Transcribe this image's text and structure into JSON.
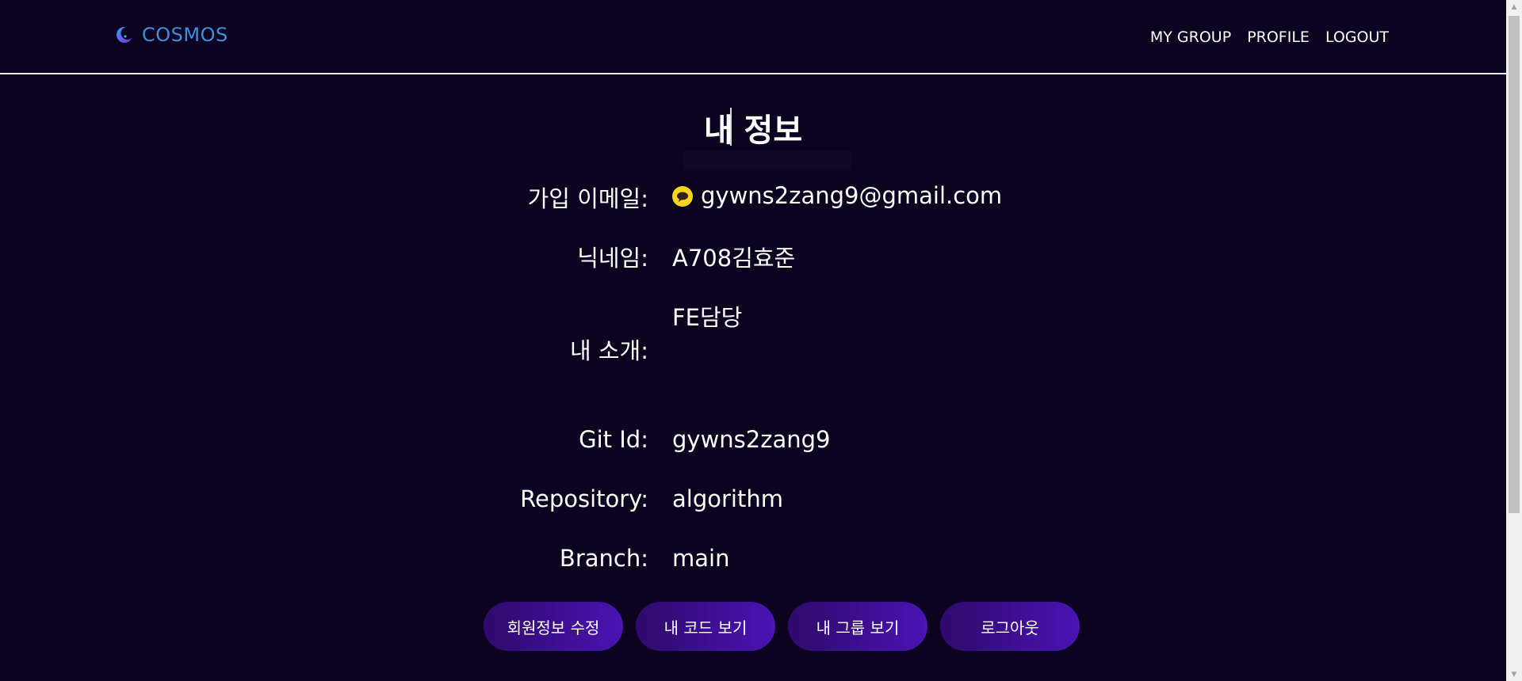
{
  "header": {
    "brand": "COSMOS",
    "nav": {
      "my_group": "MY GROUP",
      "profile": "PROFILE",
      "logout": "LOGOUT"
    }
  },
  "page": {
    "title": "내 정보"
  },
  "profile": {
    "email_label": "가입 이메일:",
    "email_value": "gywns2zang9@gmail.com",
    "nickname_label": "닉네임:",
    "nickname_value": "A708김효준",
    "intro_label": "내 소개:",
    "intro_value": "FE담당",
    "git_label": "Git Id:",
    "git_value": "gywns2zang9",
    "repo_label": "Repository:",
    "repo_value": "algorithm",
    "branch_label": "Branch:",
    "branch_value": "main"
  },
  "actions": {
    "edit_profile": "회원정보 수정",
    "my_code": "내 코드 보기",
    "my_group": "내 그룹 보기",
    "logout": "로그아웃"
  },
  "colors": {
    "background": "#0b0320",
    "brand": "#3d8fe0",
    "button_start": "#2f0a6b",
    "button_end": "#4a13b3",
    "kakao": "#f7d51d"
  },
  "icons": {
    "logo": "crescent-planet-icon",
    "email_provider": "kakao-icon"
  }
}
